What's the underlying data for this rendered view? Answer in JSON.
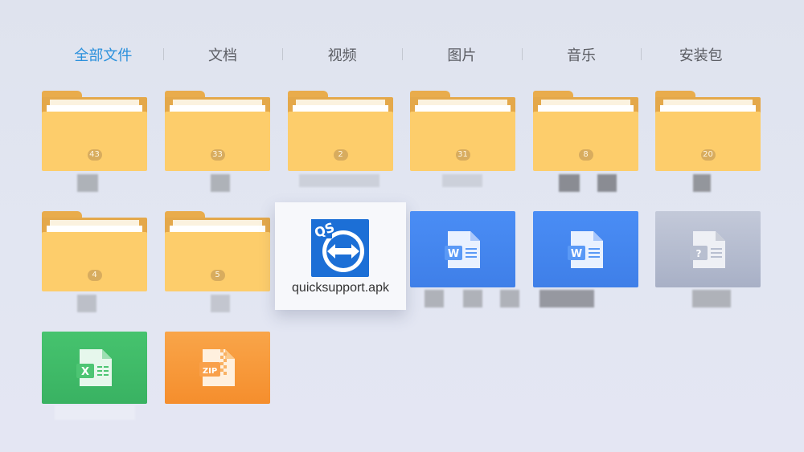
{
  "tabs": [
    {
      "label": "全部文件",
      "active": true
    },
    {
      "label": "文档",
      "active": false
    },
    {
      "label": "视频",
      "active": false
    },
    {
      "label": "图片",
      "active": false
    },
    {
      "label": "音乐",
      "active": false
    },
    {
      "label": "安装包",
      "active": false
    }
  ],
  "folders": [
    {
      "count": "43"
    },
    {
      "count": "33"
    },
    {
      "count": "2"
    },
    {
      "count": "31"
    },
    {
      "count": "8"
    },
    {
      "count": "20"
    },
    {
      "count": "4"
    },
    {
      "count": "5"
    }
  ],
  "focused_file": {
    "name": "quicksupport.apk",
    "icon": "teamviewer-quicksupport-icon",
    "badge": "QS"
  },
  "file_tiles": [
    {
      "type": "word",
      "icon": "word-doc-icon",
      "glyph": "W"
    },
    {
      "type": "word",
      "icon": "word-doc-icon",
      "glyph": "W"
    },
    {
      "type": "unknown",
      "icon": "unknown-file-icon",
      "glyph": "?"
    },
    {
      "type": "excel",
      "icon": "excel-sheet-icon",
      "glyph": "X"
    },
    {
      "type": "zip",
      "icon": "zip-archive-icon",
      "glyph": "ZIP"
    }
  ],
  "colors": {
    "accent": "#2a90dc",
    "folder": "#fdcd6b",
    "word": "#4a8df5",
    "excel": "#46c36e",
    "zip": "#f7982f"
  }
}
